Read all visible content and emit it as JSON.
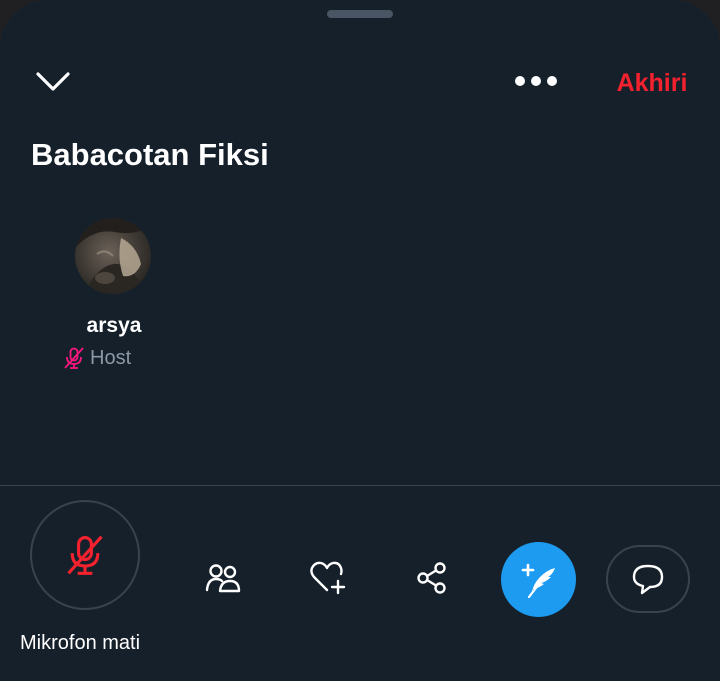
{
  "header": {
    "collapse_icon": "chevron-down-icon",
    "more_icon": "more-horizontal-icon",
    "end_label": "Akhiri"
  },
  "space": {
    "title": "Babacotan Fiksi"
  },
  "participants": [
    {
      "name": "arsya",
      "role": "Host",
      "mic_status_icon": "mic-off-icon"
    }
  ],
  "controls": {
    "mic_label": "Mikrofon mati",
    "mic_state": "muted",
    "tools": [
      "people-icon",
      "heart-add-icon",
      "share-icon",
      "compose-quill-icon",
      "comment-bubble-icon"
    ]
  },
  "colors": {
    "background": "#15202b",
    "accent_red": "#f4212e",
    "accent_blue": "#1d9bf0",
    "host_mic_pink": "#f91880",
    "muted_text": "#8b98a5",
    "divider": "#38444d"
  }
}
